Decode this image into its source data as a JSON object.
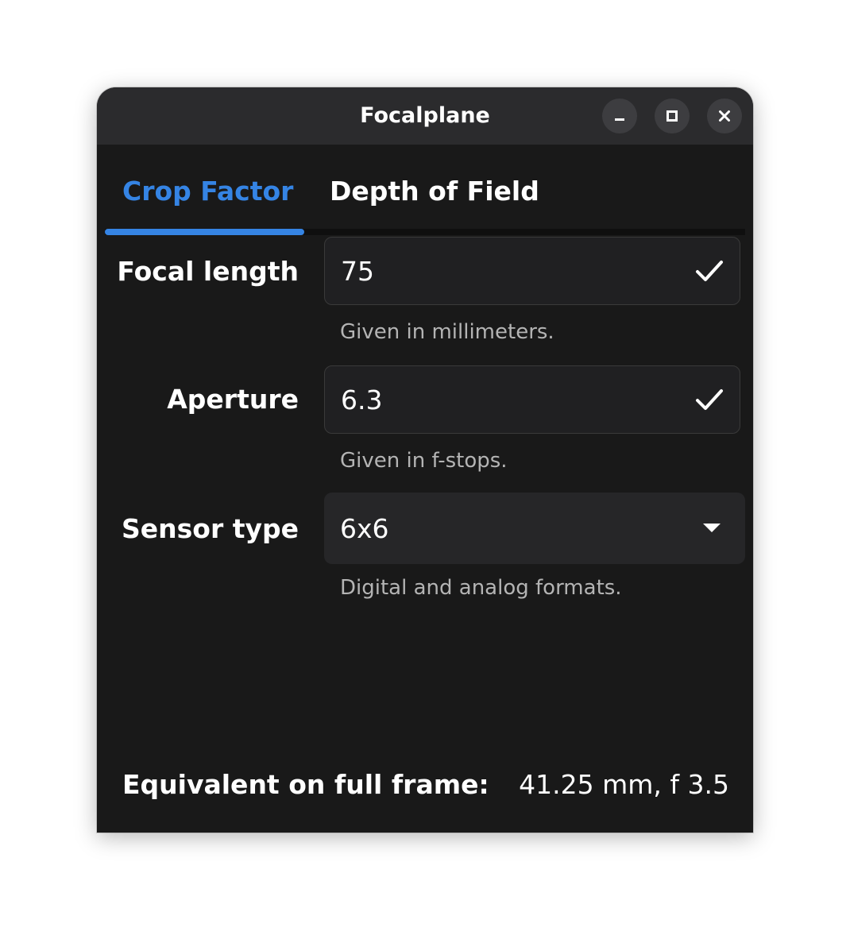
{
  "window": {
    "title": "Focalplane",
    "controls": [
      "minimize-icon",
      "maximize-icon",
      "close-icon"
    ]
  },
  "tabs": [
    {
      "label": "Crop Factor",
      "active": true
    },
    {
      "label": "Depth of Field",
      "active": false
    }
  ],
  "form": {
    "focal_length": {
      "label": "Focal length",
      "value": "75",
      "hint": "Given in millimeters.",
      "icon": "checkmark-icon"
    },
    "aperture": {
      "label": "Aperture",
      "value": "6.3",
      "hint": "Given in f-stops.",
      "icon": "checkmark-icon"
    },
    "sensor_type": {
      "label": "Sensor type",
      "value": "6x6",
      "hint": "Digital and analog formats.",
      "icon": "dropdown-arrow-icon"
    }
  },
  "result": {
    "label": "Equivalent on full frame:",
    "value": "41.25 mm, f 3.5"
  },
  "colors": {
    "accent": "#3584e4",
    "background": "#191919",
    "titlebar": "#2b2b2d",
    "text": "#ffffff",
    "hint": "#b4b4b4"
  }
}
